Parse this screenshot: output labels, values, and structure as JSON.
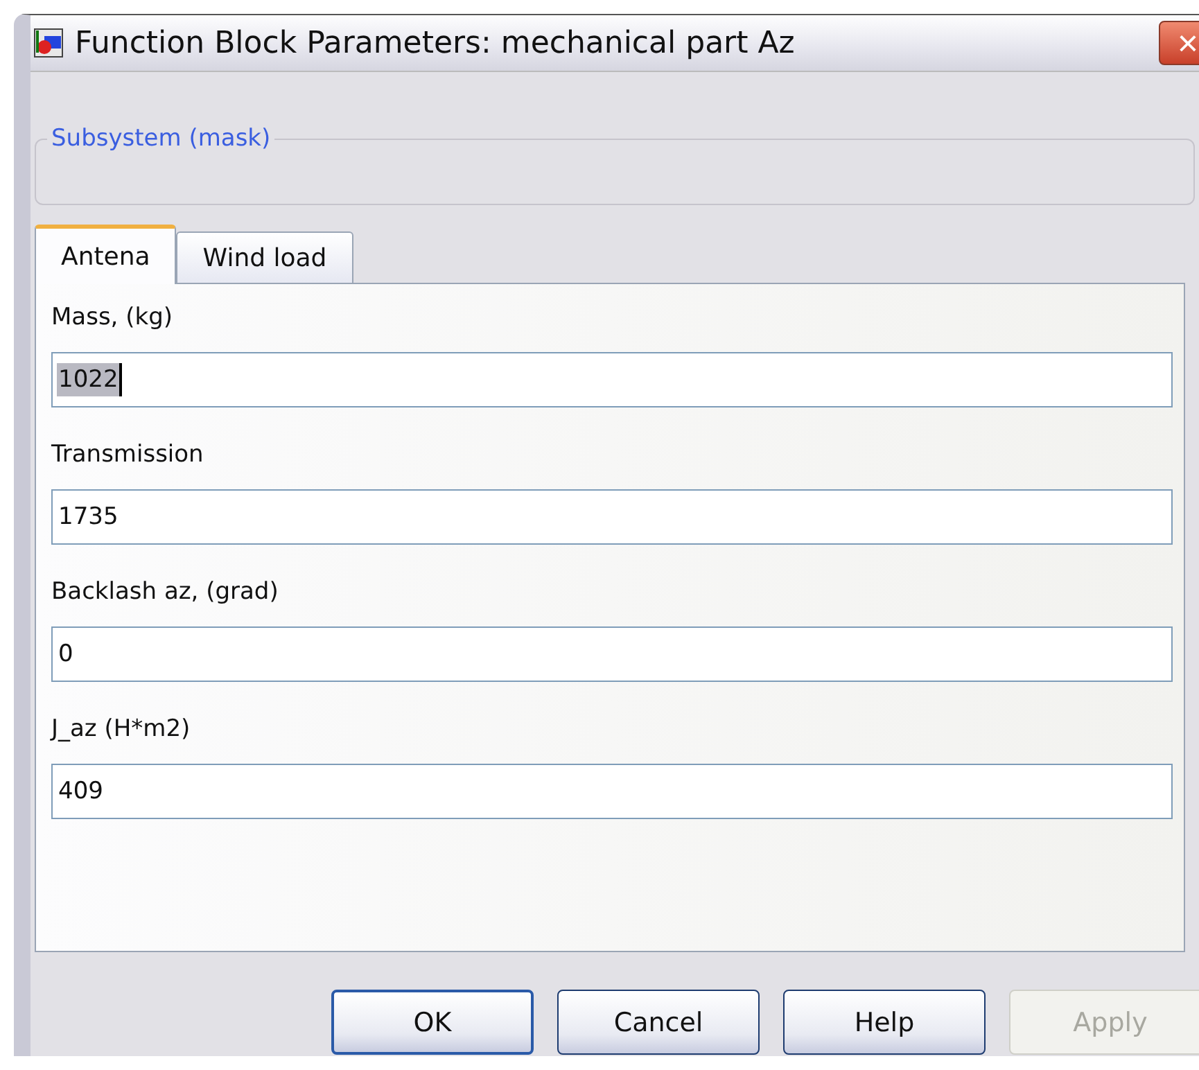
{
  "window": {
    "title": "Function Block Parameters: mechanical part Az",
    "close": "×"
  },
  "group": {
    "title": "Subsystem (mask)"
  },
  "tabs": [
    {
      "label": "Antena",
      "selected": true
    },
    {
      "label": "Wind load",
      "selected": false
    }
  ],
  "fields": [
    {
      "label": "Mass, (kg)",
      "value": "1022",
      "text_selected": true
    },
    {
      "label": "Transmission",
      "value": "1735",
      "text_selected": false
    },
    {
      "label": "Backlash az, (grad)",
      "value": "0",
      "text_selected": false
    },
    {
      "label": "J_az  (H*m2)",
      "value": "409",
      "text_selected": false
    }
  ],
  "buttons": [
    {
      "label": "OK",
      "default": true,
      "disabled": false
    },
    {
      "label": "Cancel",
      "default": false,
      "disabled": false
    },
    {
      "label": "Help",
      "default": false,
      "disabled": false
    },
    {
      "label": "Apply",
      "default": false,
      "disabled": true
    }
  ]
}
